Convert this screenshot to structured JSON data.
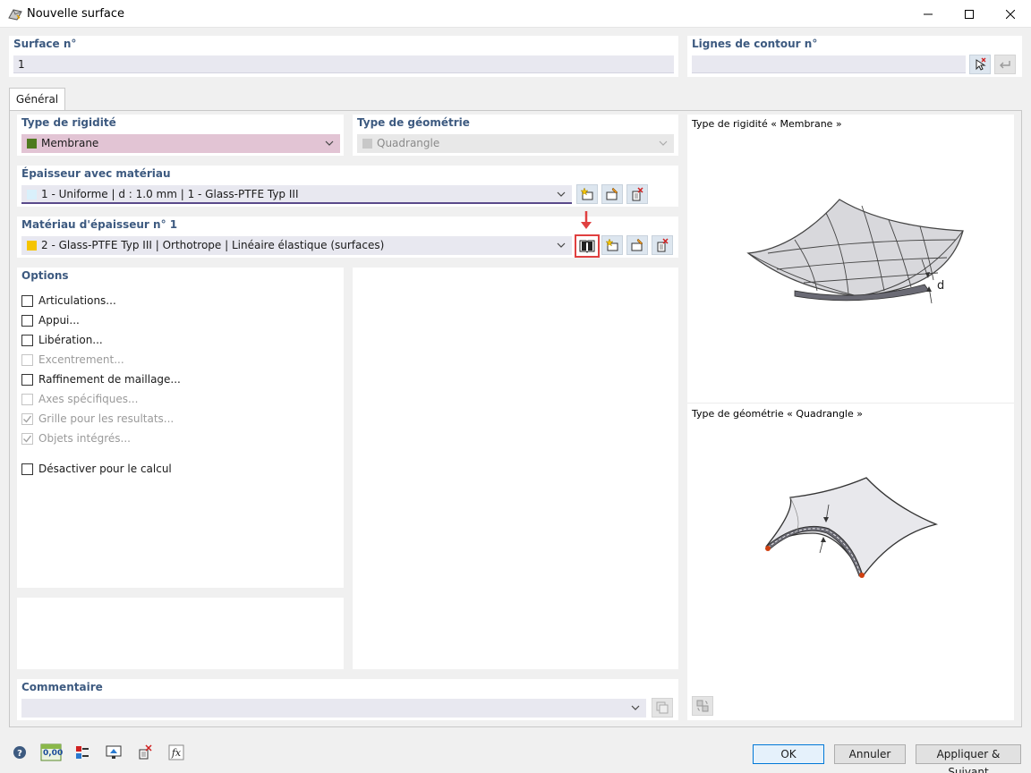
{
  "window": {
    "title": "Nouvelle surface"
  },
  "header": {
    "surface_label": "Surface n°",
    "surface_value": "1",
    "contour_label": "Lignes de contour n°",
    "contour_value": ""
  },
  "tabs": [
    {
      "label": "Général"
    }
  ],
  "rigidity": {
    "label": "Type de rigidité",
    "value": "Membrane",
    "swatch_color": "#4f7a1f",
    "field_color": "#e2c4d4"
  },
  "geometry": {
    "label": "Type de géométrie",
    "value": "Quadrangle"
  },
  "thickness": {
    "label": "Épaisseur avec matériau",
    "value": "1 - Uniforme | d : 1.0 mm | 1 - Glass-PTFE Typ III",
    "swatch_color": "#d9f0fb"
  },
  "material": {
    "label": "Matériau d'épaisseur n° 1",
    "value": "2 - Glass-PTFE Typ III | Orthotrope | Linéaire élastique (surfaces)",
    "swatch_color": "#f5c400"
  },
  "options": {
    "title": "Options",
    "items": [
      {
        "label": "Articulations...",
        "checked": false,
        "enabled": true
      },
      {
        "label": "Appui...",
        "checked": false,
        "enabled": true
      },
      {
        "label": "Libération...",
        "checked": false,
        "enabled": true
      },
      {
        "label": "Excentrement...",
        "checked": false,
        "enabled": false
      },
      {
        "label": "Raffinement de maillage...",
        "checked": false,
        "enabled": true
      },
      {
        "label": "Axes spécifiques...",
        "checked": false,
        "enabled": false
      },
      {
        "label": "Grille pour les resultats...",
        "checked": true,
        "enabled": false
      },
      {
        "label": "Objets intégrés...",
        "checked": true,
        "enabled": false
      }
    ],
    "deactivate_label": "Désactiver pour le calcul"
  },
  "comment": {
    "label": "Commentaire",
    "value": ""
  },
  "preview": {
    "rigidity_title": "Type de rigidité « Membrane »",
    "geometry_title": "Type de géométrie « Quadrangle »",
    "thickness_symbol": "d"
  },
  "footer": {
    "ok_label": "OK",
    "cancel_label": "Annuler",
    "apply_next_label": "Appliquer & Suivant",
    "units_icon_text": "0,00"
  },
  "colors": {
    "accent": "#0078d7",
    "label_blue": "#3d5a80",
    "highlight_red": "#e04040"
  }
}
